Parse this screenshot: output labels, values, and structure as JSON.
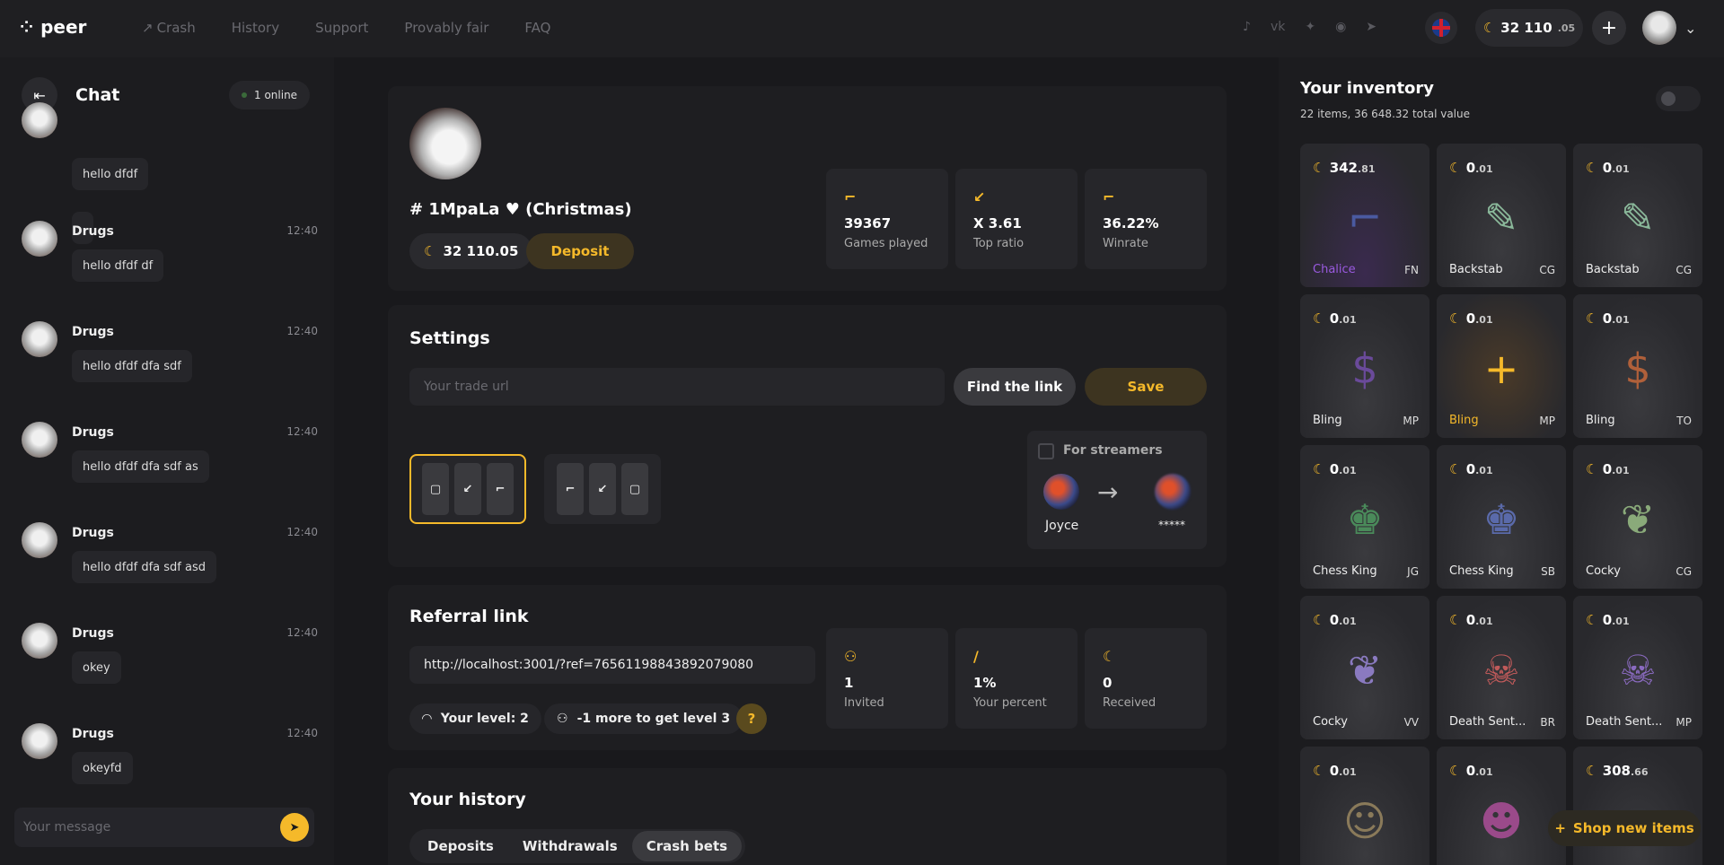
{
  "app": {
    "name": "peer"
  },
  "nav": {
    "crash": "Crash",
    "history": "History",
    "support": "Support",
    "provably_fair": "Provably fair",
    "faq": "FAQ"
  },
  "header": {
    "balance_main": "32 110",
    "balance_dec": ".05"
  },
  "chat": {
    "title": "Chat",
    "online": "1 online",
    "first_bubble": "hello dfdf",
    "messages": [
      {
        "name": "Drugs",
        "time": "12:40",
        "text": "hello dfdf df"
      },
      {
        "name": "Drugs",
        "time": "12:40",
        "text": "hello dfdf dfa sdf"
      },
      {
        "name": "Drugs",
        "time": "12:40",
        "text": "hello dfdf dfa sdf as"
      },
      {
        "name": "Drugs",
        "time": "12:40",
        "text": "hello dfdf dfa sdf asd"
      },
      {
        "name": "Drugs",
        "time": "12:40",
        "text": "okey"
      },
      {
        "name": "Drugs",
        "time": "12:40",
        "text": "okeyfd"
      }
    ],
    "input_placeholder": "Your message"
  },
  "profile": {
    "name": "# 1MpaLa ♥ (Christmas)",
    "balance": "32 110.05",
    "deposit_label": "Deposit",
    "stats": [
      {
        "value": "39367",
        "label": "Games played"
      },
      {
        "value": "X 3.61",
        "label": "Top ratio"
      },
      {
        "value": "36.22%",
        "label": "Winrate"
      }
    ]
  },
  "settings": {
    "title": "Settings",
    "trade_placeholder": "Your trade url",
    "find_label": "Find the link",
    "save_label": "Save",
    "streamers_label": "For streamers",
    "streamer_from": "Joyce",
    "streamer_to": "*****"
  },
  "referral": {
    "title": "Referral link",
    "link": "http://localhost:3001/?ref=76561198843892079080",
    "level": "Your level: 2",
    "more": "-1 more to get level 3",
    "help": "?",
    "stats": [
      {
        "value": "1",
        "label": "Invited"
      },
      {
        "value": "1%",
        "label": "Your percent"
      },
      {
        "value": "0",
        "label": "Received"
      }
    ]
  },
  "history": {
    "title": "Your history",
    "tabs": [
      "Deposits",
      "Withdrawals",
      "Crash bets"
    ]
  },
  "inventory": {
    "title": "Your inventory",
    "summary": "22 items, 36 648.32 total value",
    "items": [
      {
        "price": "342",
        "dec": ".81",
        "name": "Chalice",
        "wear": "FN"
      },
      {
        "price": "0",
        "dec": ".01",
        "name": "Backstab",
        "wear": "CG"
      },
      {
        "price": "0",
        "dec": ".01",
        "name": "Backstab",
        "wear": "CG"
      },
      {
        "price": "0",
        "dec": ".01",
        "name": "Bling",
        "wear": "MP"
      },
      {
        "price": "0",
        "dec": ".01",
        "name": "Bling",
        "wear": "MP"
      },
      {
        "price": "0",
        "dec": ".01",
        "name": "Bling",
        "wear": "TO"
      },
      {
        "price": "0",
        "dec": ".01",
        "name": "Chess King",
        "wear": "JG"
      },
      {
        "price": "0",
        "dec": ".01",
        "name": "Chess King",
        "wear": "SB"
      },
      {
        "price": "0",
        "dec": ".01",
        "name": "Cocky",
        "wear": "CG"
      },
      {
        "price": "0",
        "dec": ".01",
        "name": "Cocky",
        "wear": "VV"
      },
      {
        "price": "0",
        "dec": ".01",
        "name": "Death Sent...",
        "wear": "BR"
      },
      {
        "price": "0",
        "dec": ".01",
        "name": "Death Sent...",
        "wear": "MP"
      },
      {
        "price": "0",
        "dec": ".01",
        "name": "",
        "wear": ""
      },
      {
        "price": "0",
        "dec": ".01",
        "name": "",
        "wear": ""
      },
      {
        "price": "308",
        "dec": ".66",
        "name": "",
        "wear": ""
      }
    ],
    "shop_label": "Shop new items"
  }
}
